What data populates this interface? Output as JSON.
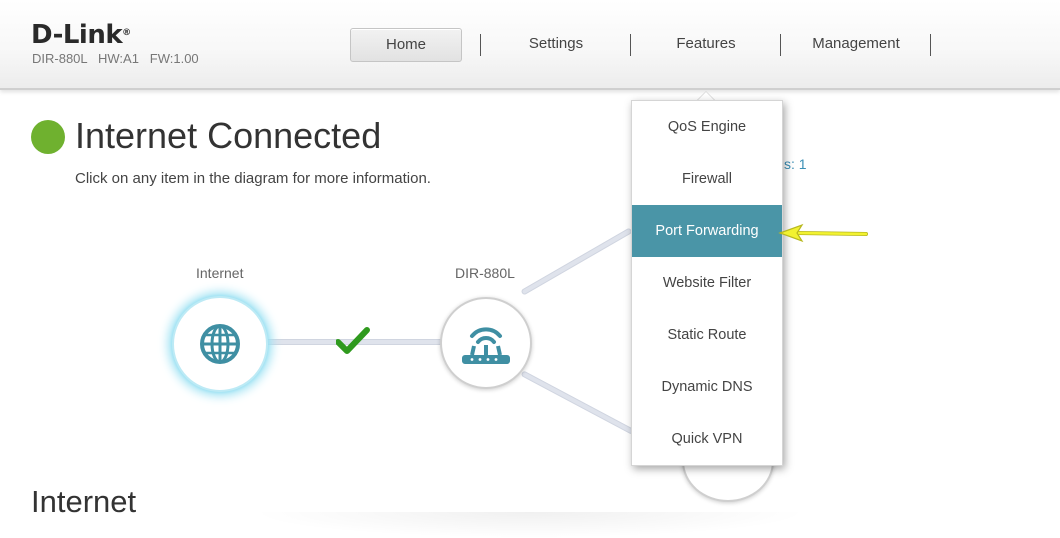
{
  "header": {
    "brand": "D-Link",
    "brand_mark": "®",
    "model_info": "DIR-880L   HW:A1   FW:1.00"
  },
  "nav": {
    "items": [
      {
        "label": "Home",
        "active": true
      },
      {
        "label": "Settings",
        "active": false
      },
      {
        "label": "Features",
        "active": false
      },
      {
        "label": "Management",
        "active": false
      }
    ]
  },
  "main": {
    "status_title": "Internet Connected",
    "status_color": "#6fb12f",
    "subtitle": "Click on any item in the diagram for more information.",
    "clients_partial": "s: 1",
    "section_title": "Internet"
  },
  "diagram": {
    "internet_label": "Internet",
    "router_label": "DIR-880L",
    "internet_icon": "globe-icon",
    "router_icon": "router-icon",
    "link_status_icon": "checkmark-icon"
  },
  "features_menu": {
    "items": [
      {
        "label": "QoS Engine"
      },
      {
        "label": "Firewall"
      },
      {
        "label": "Port Forwarding",
        "highlighted": true
      },
      {
        "label": "Website Filter"
      },
      {
        "label": "Static Route"
      },
      {
        "label": "Dynamic DNS"
      },
      {
        "label": "Quick VPN"
      }
    ],
    "highlight_color": "#4a95a7"
  },
  "annotation": {
    "pointer_icon": "yellow-arrow-icon",
    "pointer_color": "#f2f230"
  }
}
